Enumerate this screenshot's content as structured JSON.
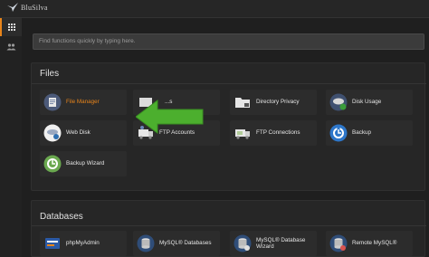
{
  "brand": {
    "name": "BluSilva"
  },
  "sidebar": {
    "items": [
      {
        "icon": "grid-icon"
      },
      {
        "icon": "users-icon"
      }
    ]
  },
  "search": {
    "placeholder": "Find functions quickly by typing here."
  },
  "files": {
    "title": "Files",
    "items": [
      {
        "label": "File Manager",
        "icon": "file-manager-icon"
      },
      {
        "label": "...s",
        "icon": "images-icon"
      },
      {
        "label": "Directory Privacy",
        "icon": "folder-icon"
      },
      {
        "label": "Disk Usage",
        "icon": "disk-usage-icon"
      },
      {
        "label": "Web Disk",
        "icon": "web-disk-icon"
      },
      {
        "label": "FTP Accounts",
        "icon": "ftp-accounts-icon"
      },
      {
        "label": "FTP Connections",
        "icon": "ftp-connections-icon"
      },
      {
        "label": "Backup",
        "icon": "backup-icon"
      },
      {
        "label": "Backup Wizard",
        "icon": "backup-wizard-icon"
      }
    ]
  },
  "databases": {
    "title": "Databases",
    "items": [
      {
        "label": "phpMyAdmin",
        "icon": "phpmyadmin-icon"
      },
      {
        "label": "MySQL® Databases",
        "icon": "database-icon"
      },
      {
        "label_line1": "MySQL® Database",
        "label_line2": "Wizard",
        "icon": "database-wizard-icon"
      },
      {
        "label": "Remote MySQL®",
        "icon": "remote-mysql-icon"
      }
    ]
  },
  "colors": {
    "accent": "#e8841a",
    "arrow": "#4caf2e",
    "background": "#1d1d1d",
    "panel": "#262626"
  }
}
